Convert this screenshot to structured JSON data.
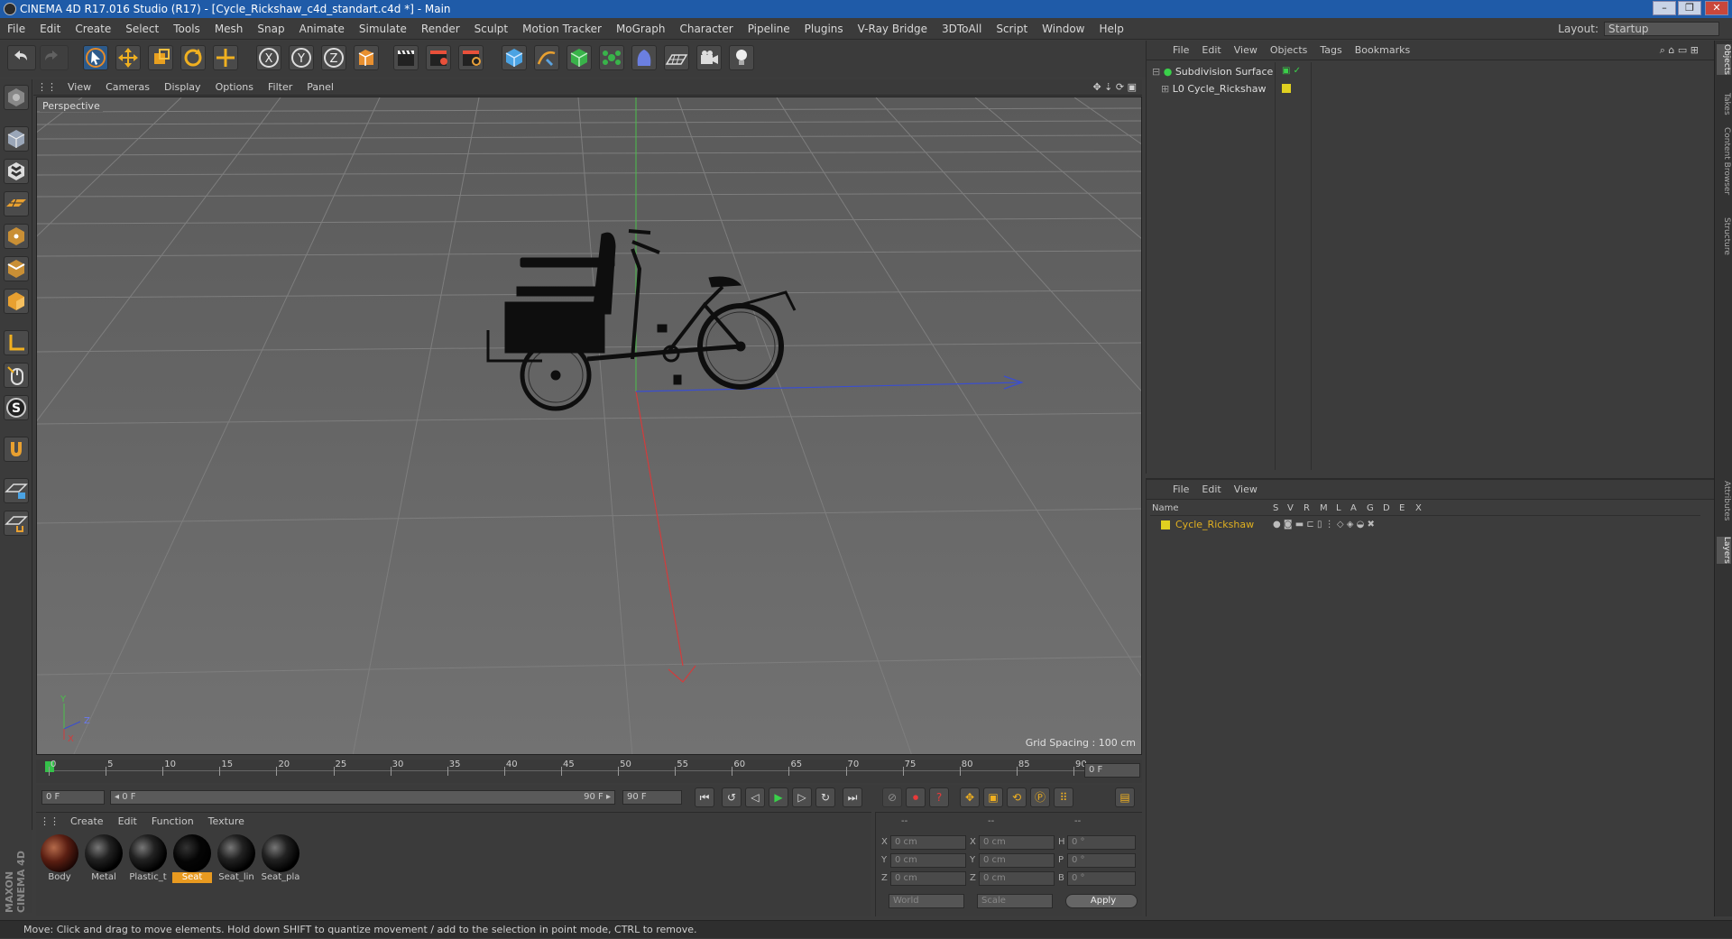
{
  "window": {
    "title": "CINEMA 4D R17.016 Studio (R17) - [Cycle_Rickshaw_c4d_standart.c4d *] - Main",
    "min": "–",
    "max": "❐",
    "close": "✕"
  },
  "menu": [
    "File",
    "Edit",
    "Create",
    "Select",
    "Tools",
    "Mesh",
    "Snap",
    "Animate",
    "Simulate",
    "Render",
    "Sculpt",
    "Motion Tracker",
    "MoGraph",
    "Character",
    "Pipeline",
    "Plugins",
    "V-Ray Bridge",
    "3DToAll",
    "Script",
    "Window",
    "Help"
  ],
  "layout": {
    "label": "Layout:",
    "value": "Startup"
  },
  "viewport": {
    "menu": [
      "View",
      "Cameras",
      "Display",
      "Options",
      "Filter",
      "Panel"
    ],
    "label": "Perspective",
    "grid_spacing": "Grid Spacing : 100 cm"
  },
  "timeline": {
    "ticks": [
      "0",
      "5",
      "10",
      "15",
      "20",
      "25",
      "30",
      "35",
      "40",
      "45",
      "50",
      "55",
      "60",
      "65",
      "70",
      "75",
      "80",
      "85",
      "90"
    ],
    "current_frame": "0 F"
  },
  "transport": {
    "start": "0 F",
    "range_start": "0 F",
    "range_end": "90 F",
    "end": "90 F"
  },
  "materials": {
    "menu": [
      "Create",
      "Edit",
      "Function",
      "Texture"
    ],
    "items": [
      {
        "name": "Body"
      },
      {
        "name": "Metal"
      },
      {
        "name": "Plastic_t"
      },
      {
        "name": "Seat"
      },
      {
        "name": "Seat_lin"
      },
      {
        "name": "Seat_pla"
      }
    ],
    "selected": "Seat"
  },
  "coords": {
    "header": [
      "--",
      "--",
      "--"
    ],
    "rows": [
      {
        "a": "X",
        "av": "0 cm",
        "b": "X",
        "bv": "0 cm",
        "c": "H",
        "cv": "0 °"
      },
      {
        "a": "Y",
        "av": "0 cm",
        "b": "Y",
        "bv": "0 cm",
        "c": "P",
        "cv": "0 °"
      },
      {
        "a": "Z",
        "av": "0 cm",
        "b": "Z",
        "bv": "0 cm",
        "c": "B",
        "cv": "0 °"
      }
    ],
    "world": "World",
    "scale": "Scale",
    "apply": "Apply"
  },
  "objects": {
    "menu": [
      "File",
      "Edit",
      "View",
      "Objects",
      "Tags",
      "Bookmarks"
    ],
    "items": [
      {
        "name": "Subdivision Surface"
      },
      {
        "name": "Cycle_Rickshaw"
      }
    ]
  },
  "layers": {
    "menu": [
      "File",
      "Edit",
      "View"
    ],
    "columns": [
      "Name",
      "S",
      "V",
      "R",
      "M",
      "L",
      "A",
      "G",
      "D",
      "E",
      "X"
    ],
    "items": [
      {
        "name": "Cycle_Rickshaw"
      }
    ],
    "accent": "#e0b020"
  },
  "right_tabs": [
    "Objects",
    "Takes",
    "Content Browser",
    "Structure",
    "Attributes",
    "Layers"
  ],
  "status": "Move: Click and drag to move elements. Hold down SHIFT to quantize movement / add to the selection in point mode, CTRL to remove.",
  "brand": "MAXON CINEMA 4D",
  "axis": {
    "x": "X",
    "y": "Y",
    "z": "Z"
  }
}
